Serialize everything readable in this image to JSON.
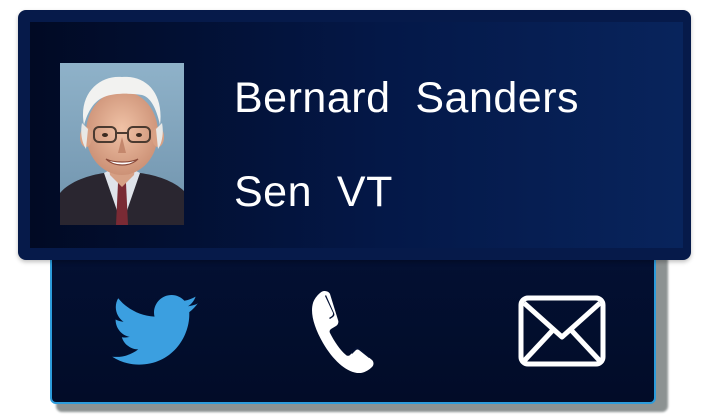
{
  "card": {
    "name": "Bernard  Sanders",
    "office": "Sen  VT"
  },
  "actions": [
    {
      "id": "twitter",
      "icon": "twitter-bird-icon",
      "color": "#3b9fe0"
    },
    {
      "id": "phone",
      "icon": "phone-handset-icon",
      "color": "#ffffff"
    },
    {
      "id": "email",
      "icon": "envelope-icon",
      "color": "#ffffff"
    }
  ],
  "colors": {
    "card_bg": "#061a4a",
    "tray_bg": "#031033",
    "tray_border": "#2d9cdb",
    "text": "#ffffff"
  }
}
